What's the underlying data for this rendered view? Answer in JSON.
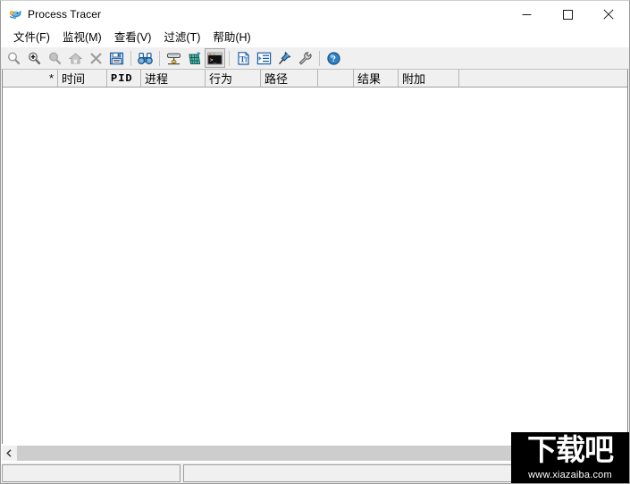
{
  "window": {
    "title": "Process Tracer",
    "icon": "app-fish-icon",
    "controls": {
      "minimize": "—",
      "maximize": "□",
      "close": "✕"
    }
  },
  "menubar": {
    "items": [
      {
        "label": "文件(F)",
        "name": "menu-file"
      },
      {
        "label": "监视(M)",
        "name": "menu-monitor"
      },
      {
        "label": "查看(V)",
        "name": "menu-view"
      },
      {
        "label": "过滤(T)",
        "name": "menu-filter"
      },
      {
        "label": "帮助(H)",
        "name": "menu-help"
      }
    ]
  },
  "toolbar": {
    "buttons": [
      {
        "name": "zoom-search-icon",
        "icon": "magnifier",
        "enabled": false,
        "pressed": false
      },
      {
        "name": "zoom-in-icon",
        "icon": "magnifier-plus",
        "enabled": false,
        "pressed": false
      },
      {
        "name": "zoom-out-icon",
        "icon": "magnifier-minus",
        "enabled": false,
        "pressed": false
      },
      {
        "name": "home-icon",
        "icon": "home",
        "enabled": false,
        "pressed": false
      },
      {
        "name": "clear-icon",
        "icon": "cross",
        "enabled": false,
        "pressed": false
      },
      {
        "name": "save-icon",
        "icon": "save-disk",
        "enabled": true,
        "pressed": false
      },
      {
        "separator": true
      },
      {
        "name": "find-icon",
        "icon": "binoculars",
        "enabled": true,
        "pressed": false
      },
      {
        "separator": true
      },
      {
        "name": "filter-icon",
        "icon": "filter-funnel",
        "enabled": true,
        "pressed": false
      },
      {
        "name": "highlight-icon",
        "icon": "highlight-grid",
        "enabled": true,
        "pressed": false
      },
      {
        "name": "console-icon",
        "icon": "console-window",
        "enabled": true,
        "pressed": true
      },
      {
        "separator": true
      },
      {
        "name": "text-format-icon",
        "icon": "text-page",
        "enabled": true,
        "pressed": false
      },
      {
        "name": "indent-icon",
        "icon": "list-indent",
        "enabled": true,
        "pressed": false
      },
      {
        "name": "pin-icon",
        "icon": "pushpin",
        "enabled": true,
        "pressed": false
      },
      {
        "name": "options-icon",
        "icon": "wrench",
        "enabled": true,
        "pressed": false
      },
      {
        "separator": true
      },
      {
        "name": "about-icon",
        "icon": "help-question",
        "enabled": true,
        "pressed": false
      }
    ]
  },
  "listview": {
    "columns": [
      {
        "label": "*",
        "width": 62,
        "align": "right",
        "mono": false
      },
      {
        "label": "时间",
        "width": 55,
        "align": "left",
        "mono": false
      },
      {
        "label": "PID",
        "width": 38,
        "align": "left",
        "mono": true
      },
      {
        "label": "进程",
        "width": 72,
        "align": "left",
        "mono": false
      },
      {
        "label": "行为",
        "width": 62,
        "align": "left",
        "mono": false
      },
      {
        "label": "路径",
        "width": 64,
        "align": "left",
        "mono": false
      },
      {
        "label": "",
        "width": 40,
        "align": "left",
        "mono": false
      },
      {
        "label": "结果",
        "width": 50,
        "align": "left",
        "mono": false
      },
      {
        "label": "附加",
        "width": 68,
        "align": "left",
        "mono": false
      }
    ],
    "rows": []
  },
  "hscrollbar": {
    "left_arrow": "‹",
    "position": 0
  },
  "statusbar": {
    "panel1": "",
    "panel2": ""
  },
  "watermark": {
    "glyphs": "下载吧",
    "url": "www.xiazaiba.com"
  },
  "colors": {
    "window_bg": "#ffffff",
    "toolbar_bg": "#f0f0f0",
    "header_bg": "#f0f0f0",
    "scroll_track": "#cdcdcd",
    "border": "#828282",
    "accent": "#1b6fb5"
  }
}
